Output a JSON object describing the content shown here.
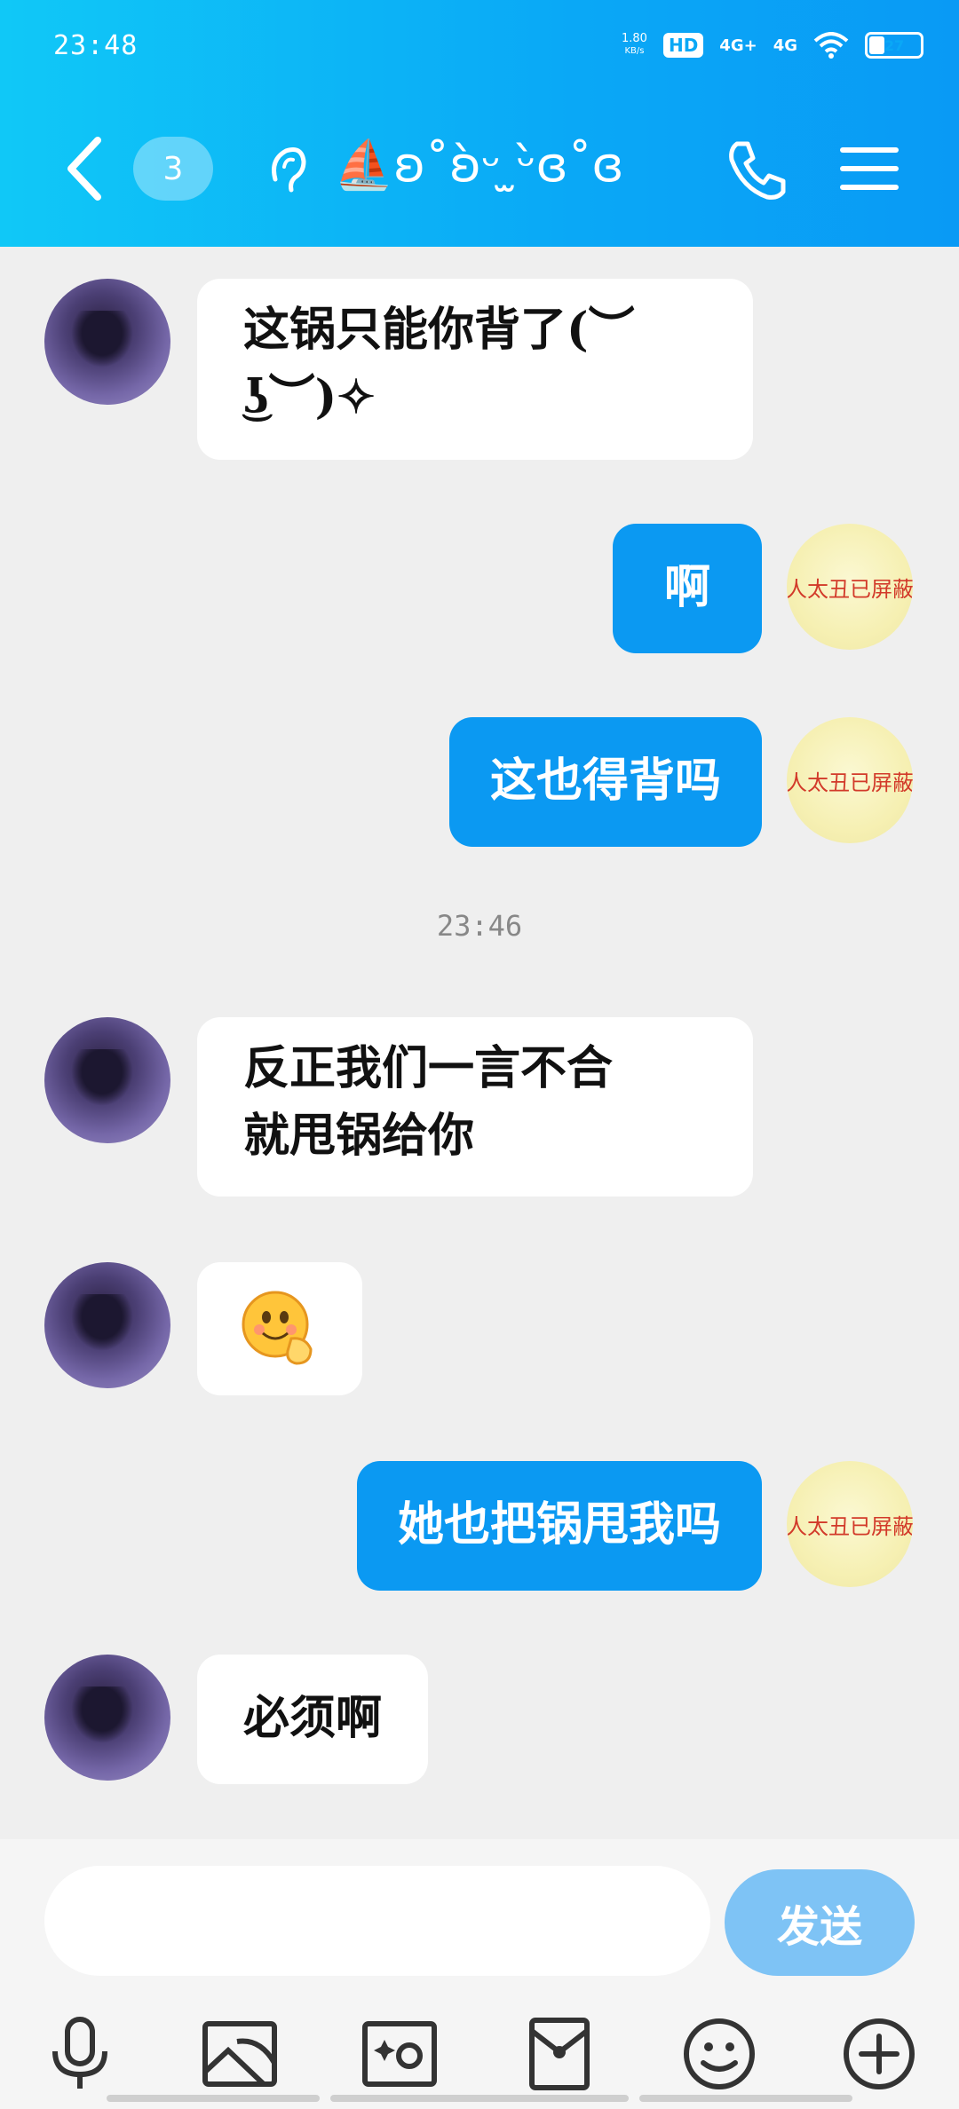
{
  "status_bar": {
    "time": "23:48",
    "network_speed_top": "1.80",
    "network_speed_unit": "KB/s",
    "hd_label": "HD",
    "signal1": "4G+",
    "signal2": "4G",
    "battery": "27"
  },
  "header": {
    "unread_count": "3",
    "title": "⛵ʚ˚ʚ̀ᵕ ̫ᵕ̀ɞ˚ɞ"
  },
  "messages": [
    {
      "side": "left",
      "text_lines": [
        "这锅只能你背了(︶",
        "͜ʖ︶)✧"
      ]
    },
    {
      "side": "right",
      "text": "啊",
      "avatar_text": "人太丑已屏蔽"
    },
    {
      "side": "right",
      "text": "这也得背吗",
      "avatar_text": "人太丑已屏蔽"
    },
    {
      "type": "timestamp",
      "text": "23:46"
    },
    {
      "side": "left",
      "text_lines": [
        "反正我们一言不合",
        "就甩锅给你"
      ]
    },
    {
      "side": "left",
      "type": "emoji",
      "emoji_name": "sly-smile-emoji"
    },
    {
      "side": "right",
      "text": "她也把锅甩我吗",
      "avatar_text": "人太丑已屏蔽"
    },
    {
      "side": "left",
      "text": "必须啊"
    }
  ],
  "input": {
    "placeholder": "",
    "send_label": "发送"
  },
  "toolbar": {
    "icons": [
      "microphone-icon",
      "gallery-icon",
      "camera-icon",
      "red-packet-icon",
      "emoji-icon",
      "plus-icon"
    ]
  },
  "colors": {
    "header_gradient_start": "#10c8f7",
    "header_gradient_end": "#099af5",
    "bubble_right": "#0b99f2",
    "send_button": "#7ec3f5"
  }
}
